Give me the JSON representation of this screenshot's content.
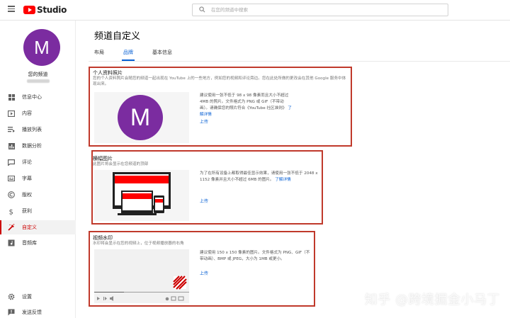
{
  "header": {
    "logo_text": "Studio",
    "search_placeholder": "在您的频道中搜索"
  },
  "sidebar": {
    "avatar_letter": "M",
    "channel_title": "您的频道",
    "items": [
      {
        "label": "信息中心",
        "icon": "dashboard-icon"
      },
      {
        "label": "内容",
        "icon": "content-icon"
      },
      {
        "label": "播放列表",
        "icon": "playlists-icon"
      },
      {
        "label": "数据分析",
        "icon": "analytics-icon"
      },
      {
        "label": "评论",
        "icon": "comments-icon"
      },
      {
        "label": "字幕",
        "icon": "subtitles-icon"
      },
      {
        "label": "版权",
        "icon": "copyright-icon"
      },
      {
        "label": "获利",
        "icon": "monetization-icon"
      },
      {
        "label": "自定义",
        "icon": "customization-icon",
        "active": true
      },
      {
        "label": "音频库",
        "icon": "audio-library-icon"
      }
    ],
    "bottom_items": [
      {
        "label": "设置",
        "icon": "gear-icon"
      },
      {
        "label": "发送反馈",
        "icon": "feedback-icon"
      }
    ]
  },
  "main": {
    "title": "频道自定义",
    "tabs": [
      {
        "label": "布局",
        "active": false
      },
      {
        "label": "品牌",
        "active": true
      },
      {
        "label": "基本信息",
        "active": false
      }
    ],
    "profile_picture": {
      "title": "个人资料照片",
      "description": "您的个人资料照片会随您的频道一起出现在 YouTube 上的一些地方，例如您的视频和评论旁边。您在此处所做的更改会在其他 Google 服务中体现出来。",
      "avatar_letter": "M",
      "hint": "建议使用一张不低于 98 x 98 像素而且大小不超过 4MB 的照片。文件格式为 PNG 或 GIF（不带动画）。请确保您的照片符合《YouTube 社区准则》",
      "learn_more": "了解详情",
      "upload": "上传"
    },
    "banner": {
      "title": "横幅图片",
      "description": "此图片将会显示在您频道的顶部",
      "hint": "为了在所有设备上都取得最佳显示效果，请使用一张不低于 2048 x 1152 像素并且大小不超过 6MB 的图片。",
      "learn_more": "了解详情",
      "upload": "上传"
    },
    "watermark": {
      "title": "视频水印",
      "description": "水印将会显示在您的视频上，位于视频播放器的右角",
      "hint": "建议使用 150 x 150 像素的图片。文件格式为 PNG、GIF（不带动画）、BMP 或 JPEG，大小为 1MB 或更小。",
      "upload": "上传"
    }
  },
  "overlay_watermark": "知乎 @跨境掘金小马丁",
  "colors": {
    "accent": "#065fd4",
    "youtube_red": "#ff0000",
    "active_red": "#cc0000",
    "avatar_purple": "#7b2ca0",
    "highlight_border": "#c0392b"
  }
}
